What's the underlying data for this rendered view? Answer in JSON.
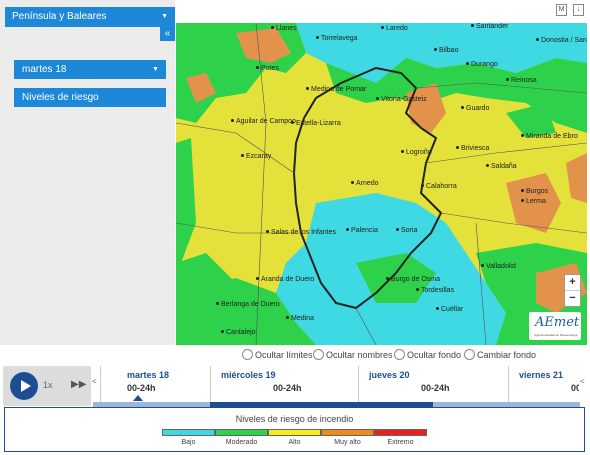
{
  "sidebar": {
    "region": "Península y Baleares",
    "collapse_icon": "«",
    "day": "martes 18",
    "layer": "Niveles de riesgo"
  },
  "top_icons": [
    "M",
    "↓"
  ],
  "map": {
    "cities": [
      {
        "name": "Llanes"
      },
      {
        "name": "Laredo"
      },
      {
        "name": "Torrelavega"
      },
      {
        "name": "Santander"
      },
      {
        "name": "Donostia / San Sebastián"
      },
      {
        "name": "Bilbao"
      },
      {
        "name": "Durango"
      },
      {
        "name": "Reinosa"
      },
      {
        "name": "Potes"
      },
      {
        "name": "Medina de Pomar"
      },
      {
        "name": "Vitoria-Gasteiz"
      },
      {
        "name": "Guardo"
      },
      {
        "name": "Aguilar de Campoo"
      },
      {
        "name": "Estella-Lizarra"
      },
      {
        "name": "Miranda de Ebro"
      },
      {
        "name": "Briviesca"
      },
      {
        "name": "Logroño"
      },
      {
        "name": "Saldaña"
      },
      {
        "name": "Ezcaray"
      },
      {
        "name": "Calahorra"
      },
      {
        "name": "Burgos"
      },
      {
        "name": "Arnedo"
      },
      {
        "name": "Lerma"
      },
      {
        "name": "Palencia"
      },
      {
        "name": "Salas de los Infantes"
      },
      {
        "name": "Soria"
      },
      {
        "name": "Valladolid"
      },
      {
        "name": "Aranda de Duero"
      },
      {
        "name": "Burgo de Osma"
      },
      {
        "name": "Tordesillas"
      },
      {
        "name": "Berlanga de Duero"
      },
      {
        "name": "Cuéllar"
      },
      {
        "name": "Medina"
      },
      {
        "name": "Cantalejo"
      }
    ],
    "zoom_in": "+",
    "zoom_out": "−",
    "logo_text": "AEmet",
    "logo_sub": "Agencia Estatal de Meteorología"
  },
  "options": [
    "Ocultar límites",
    "Ocultar nombres",
    "Ocultar fondo",
    "Cambiar fondo"
  ],
  "player": {
    "speed": "1x",
    "ff_icon": "▶▶"
  },
  "timeline": {
    "nav_left": "<",
    "nav_right": "<",
    "days": [
      {
        "day": "martes 18",
        "hours": "00-24h"
      },
      {
        "day": "miércoles 19",
        "hours": "00-24h"
      },
      {
        "day": "jueves 20",
        "hours": "00-24h"
      },
      {
        "day": "viernes 21",
        "hours": "00-24h"
      }
    ]
  },
  "legend": {
    "title": "Niveles de riesgo de incendio",
    "levels": [
      {
        "label": "Bajo",
        "color": "#3ed9e2"
      },
      {
        "label": "Moderado",
        "color": "#2ed24a"
      },
      {
        "label": "Alto",
        "color": "#f3ec1e"
      },
      {
        "label": "Muy alto",
        "color": "#f08a1c"
      },
      {
        "label": "Extremo",
        "color": "#e8211b"
      }
    ]
  },
  "colors": {
    "accent": "#1e88d8",
    "dark": "#1d4e94",
    "low": "#3ed9e2",
    "moderate": "#2ed24a",
    "high": "#e4e13a",
    "very_high": "#e2924a"
  }
}
